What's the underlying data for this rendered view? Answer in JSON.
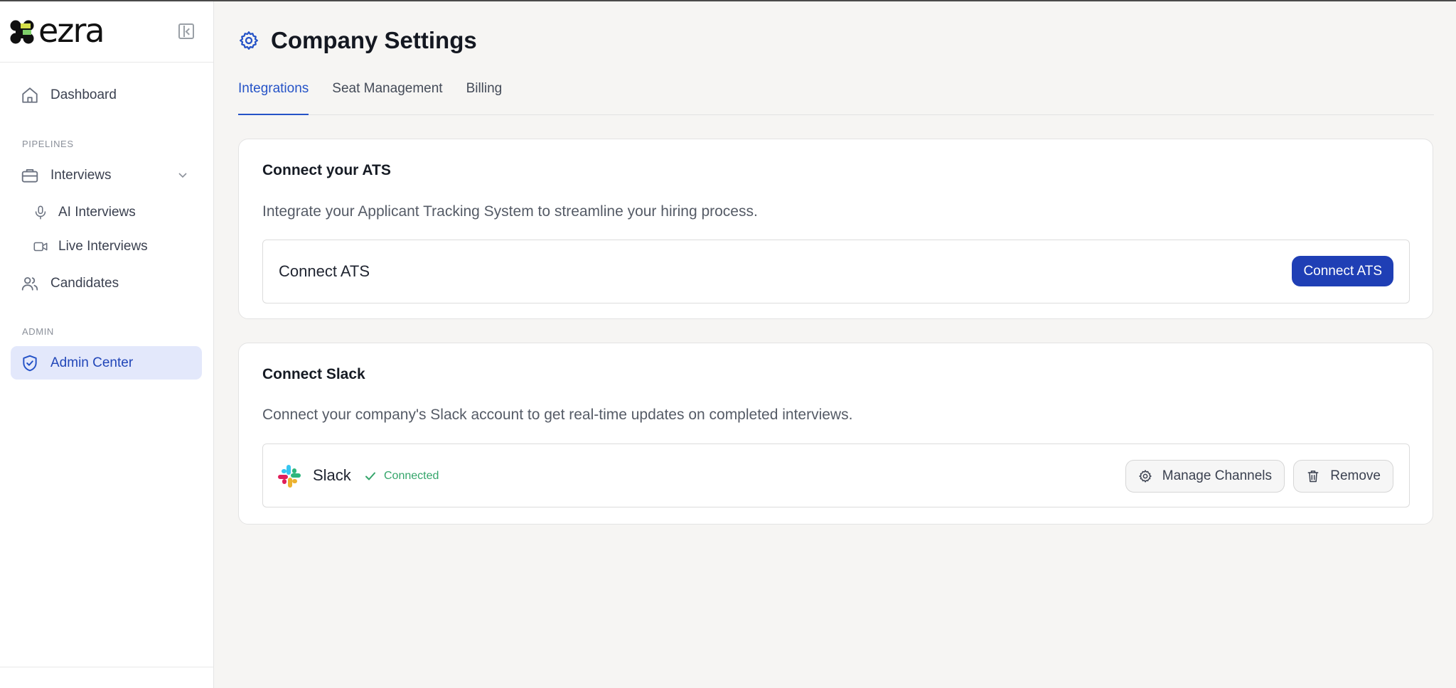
{
  "app": {
    "logo_text": "ezra"
  },
  "sidebar": {
    "items": [
      {
        "label": "Dashboard",
        "icon": "home-icon"
      },
      {
        "label": "Interviews",
        "icon": "briefcase-icon"
      },
      {
        "label": "AI Interviews",
        "icon": "microphone-icon"
      },
      {
        "label": "Live Interviews",
        "icon": "video-icon"
      },
      {
        "label": "Candidates",
        "icon": "users-icon"
      },
      {
        "label": "Admin Center",
        "icon": "shield-check-icon"
      }
    ],
    "sections": {
      "pipelines": "PIPELINES",
      "admin": "ADMIN"
    }
  },
  "page": {
    "title": "Company Settings",
    "icon": "gear-icon"
  },
  "tabs": [
    {
      "label": "Integrations",
      "active": true
    },
    {
      "label": "Seat Management",
      "active": false
    },
    {
      "label": "Billing",
      "active": false
    }
  ],
  "ats_card": {
    "title": "Connect your ATS",
    "description": "Integrate your Applicant Tracking System to streamline your hiring process.",
    "row_label": "Connect ATS",
    "button_label": "Connect ATS"
  },
  "slack_card": {
    "title": "Connect Slack",
    "description": "Connect your company's Slack account to get real-time updates on completed interviews.",
    "service_name": "Slack",
    "status": "Connected",
    "manage_label": "Manage Channels",
    "remove_label": "Remove"
  },
  "colors": {
    "accent": "#2553c7",
    "primary_button": "#1f3fb5",
    "active_nav_bg": "#e3e8fb",
    "success": "#34a56a"
  }
}
